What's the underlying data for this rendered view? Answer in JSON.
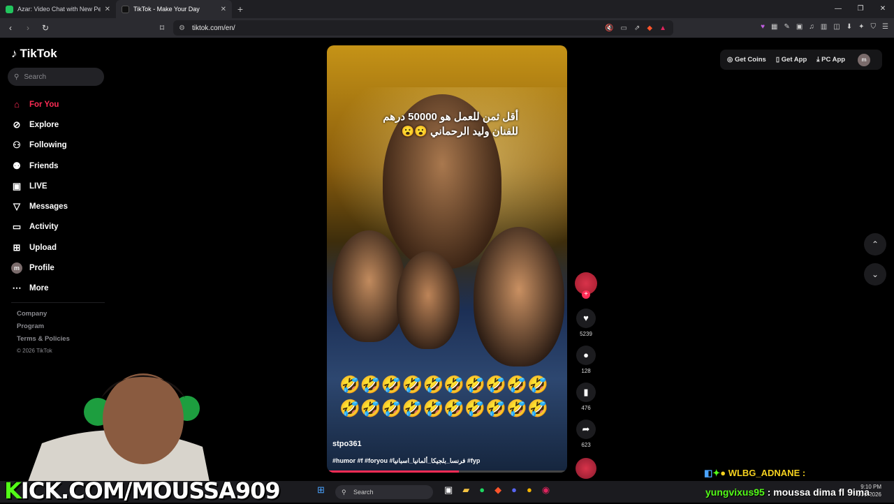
{
  "browser": {
    "tabs": [
      {
        "title": "Azar: Video Chat with New Peopl",
        "active": false,
        "favicon_color": "#22c55e"
      },
      {
        "title": "TikTok - Make Your Day",
        "active": true,
        "favicon_color": "#111111"
      }
    ],
    "url": "tiktok.com/en/"
  },
  "sidebar": {
    "logo": "TikTok",
    "search_placeholder": "Search",
    "items": [
      {
        "label": "For You",
        "icon": "home-icon"
      },
      {
        "label": "Explore",
        "icon": "compass-icon"
      },
      {
        "label": "Following",
        "icon": "user-follow-icon"
      },
      {
        "label": "Friends",
        "icon": "friends-icon"
      },
      {
        "label": "LIVE",
        "icon": "live-icon"
      },
      {
        "label": "Messages",
        "icon": "send-icon"
      },
      {
        "label": "Activity",
        "icon": "inbox-icon"
      },
      {
        "label": "Upload",
        "icon": "plus-square-icon"
      },
      {
        "label": "Profile",
        "icon": "avatar-icon",
        "avatar_letter": "m"
      },
      {
        "label": "More",
        "icon": "dots-icon"
      }
    ],
    "footer": [
      "Company",
      "Program",
      "Terms & Policies",
      "© 2026 TikTok"
    ]
  },
  "topright": {
    "get_coins": "Get Coins",
    "get_app": "Get App",
    "pc_app": "PC App",
    "avatar_letter": "m"
  },
  "video": {
    "caption_line1": "أقل ثمن للعمل هو 50000 درهم",
    "caption_line2": "للفنان وليد الرحماني 😮😮",
    "emoji_row1": "🤣🤣🤣🤣🤣🤣🤣🤣🤣🤣",
    "emoji_row2": "🤣🤣🤣🤣🤣🤣🤣🤣🤣🤣",
    "username": "stpo361",
    "tags": "#humor #f #foryou #فرنسا_بلجيكا_ألمانيا_اسبانيا #fyp",
    "progress": 0.55
  },
  "actions": {
    "likes": "5239",
    "comments": "128",
    "saves": "476",
    "shares": "623"
  },
  "overlay": {
    "kick_prefix": "K",
    "kick_text": "ICK.COM/MOUSSA909",
    "chat1_user": "WLBG_ADNANE :",
    "chat2_user": "yungvixus95",
    "chat2_msg": ": moussa dima fl 9ima"
  },
  "taskbar": {
    "search": "Search",
    "time": "9:10 PM",
    "date": "1/31/2026"
  }
}
